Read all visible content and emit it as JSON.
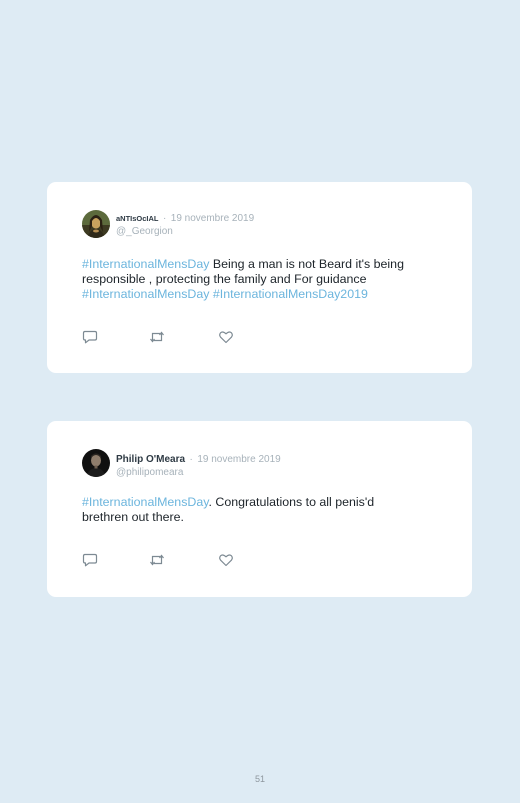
{
  "tweets": [
    {
      "author": "aNTIsOcIAL",
      "separator": "·",
      "date": "19 novembre 2019",
      "handle": "@_Georgion",
      "body": [
        {
          "type": "tag",
          "text": "#InternationalMensDay"
        },
        {
          "type": "text",
          "text": " Being a man is not Beard it's being responsible , protecting the family and For guidance "
        },
        {
          "type": "tag",
          "text": "#InternationalMensDay"
        },
        {
          "type": "text",
          "text": " "
        },
        {
          "type": "tag",
          "text": "#InternationalMensDay2019"
        }
      ],
      "avatar_icon": "mona-lisa-avatar"
    },
    {
      "author": "Philip O'Meara",
      "separator": "·",
      "date": "19 novembre 2019",
      "handle": "@philipomeara",
      "body": [
        {
          "type": "tag",
          "text": "#InternationalMensDay"
        },
        {
          "type": "text",
          "text": ". Congratulations to all penis'd brethren out there."
        }
      ],
      "avatar_icon": "dark-portrait-avatar"
    }
  ],
  "actions": [
    "reply-icon",
    "retweet-icon",
    "like-icon"
  ],
  "colors": {
    "background": "#deebf4",
    "card": "#ffffff",
    "hashtag": "#6cb5dd",
    "muted": "#a7b2ba",
    "icon": "#7d8a93"
  },
  "page_number": "51"
}
